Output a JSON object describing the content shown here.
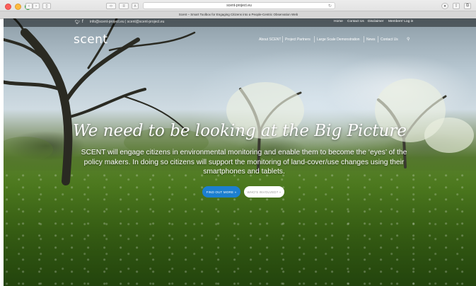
{
  "browser": {
    "url": "scent-project.eu",
    "tab_title": "Scent – Smart Toolbox for Engaging Citizens into a People-Centric Observation Web"
  },
  "topbar": {
    "email": "info@scent-project.eu | scent@scent-project.eu",
    "links": [
      "Home",
      "Contact Us",
      "Disclaimer",
      "Members' Log in"
    ]
  },
  "header": {
    "logo": "scent",
    "nav": [
      "About SCENT",
      "Project Partners",
      "Large Scale Demonstration",
      "News",
      "Contact Us"
    ]
  },
  "hero": {
    "headline": "We need to be looking at the Big Picture",
    "subtext": "SCENT will engage citizens in environmental monitoring and enable them to become the ‘eyes’ of the policy makers. In doing so citizens will support the monitoring of land-cover/use changes using their smartphones and tablets.",
    "primary_button": "FIND OUT MORE »",
    "secondary_button": "WHO'S INVOLVED? »"
  },
  "icons": {
    "social": [
      "twitter-icon",
      "facebook-icon"
    ],
    "search": "search-icon"
  }
}
